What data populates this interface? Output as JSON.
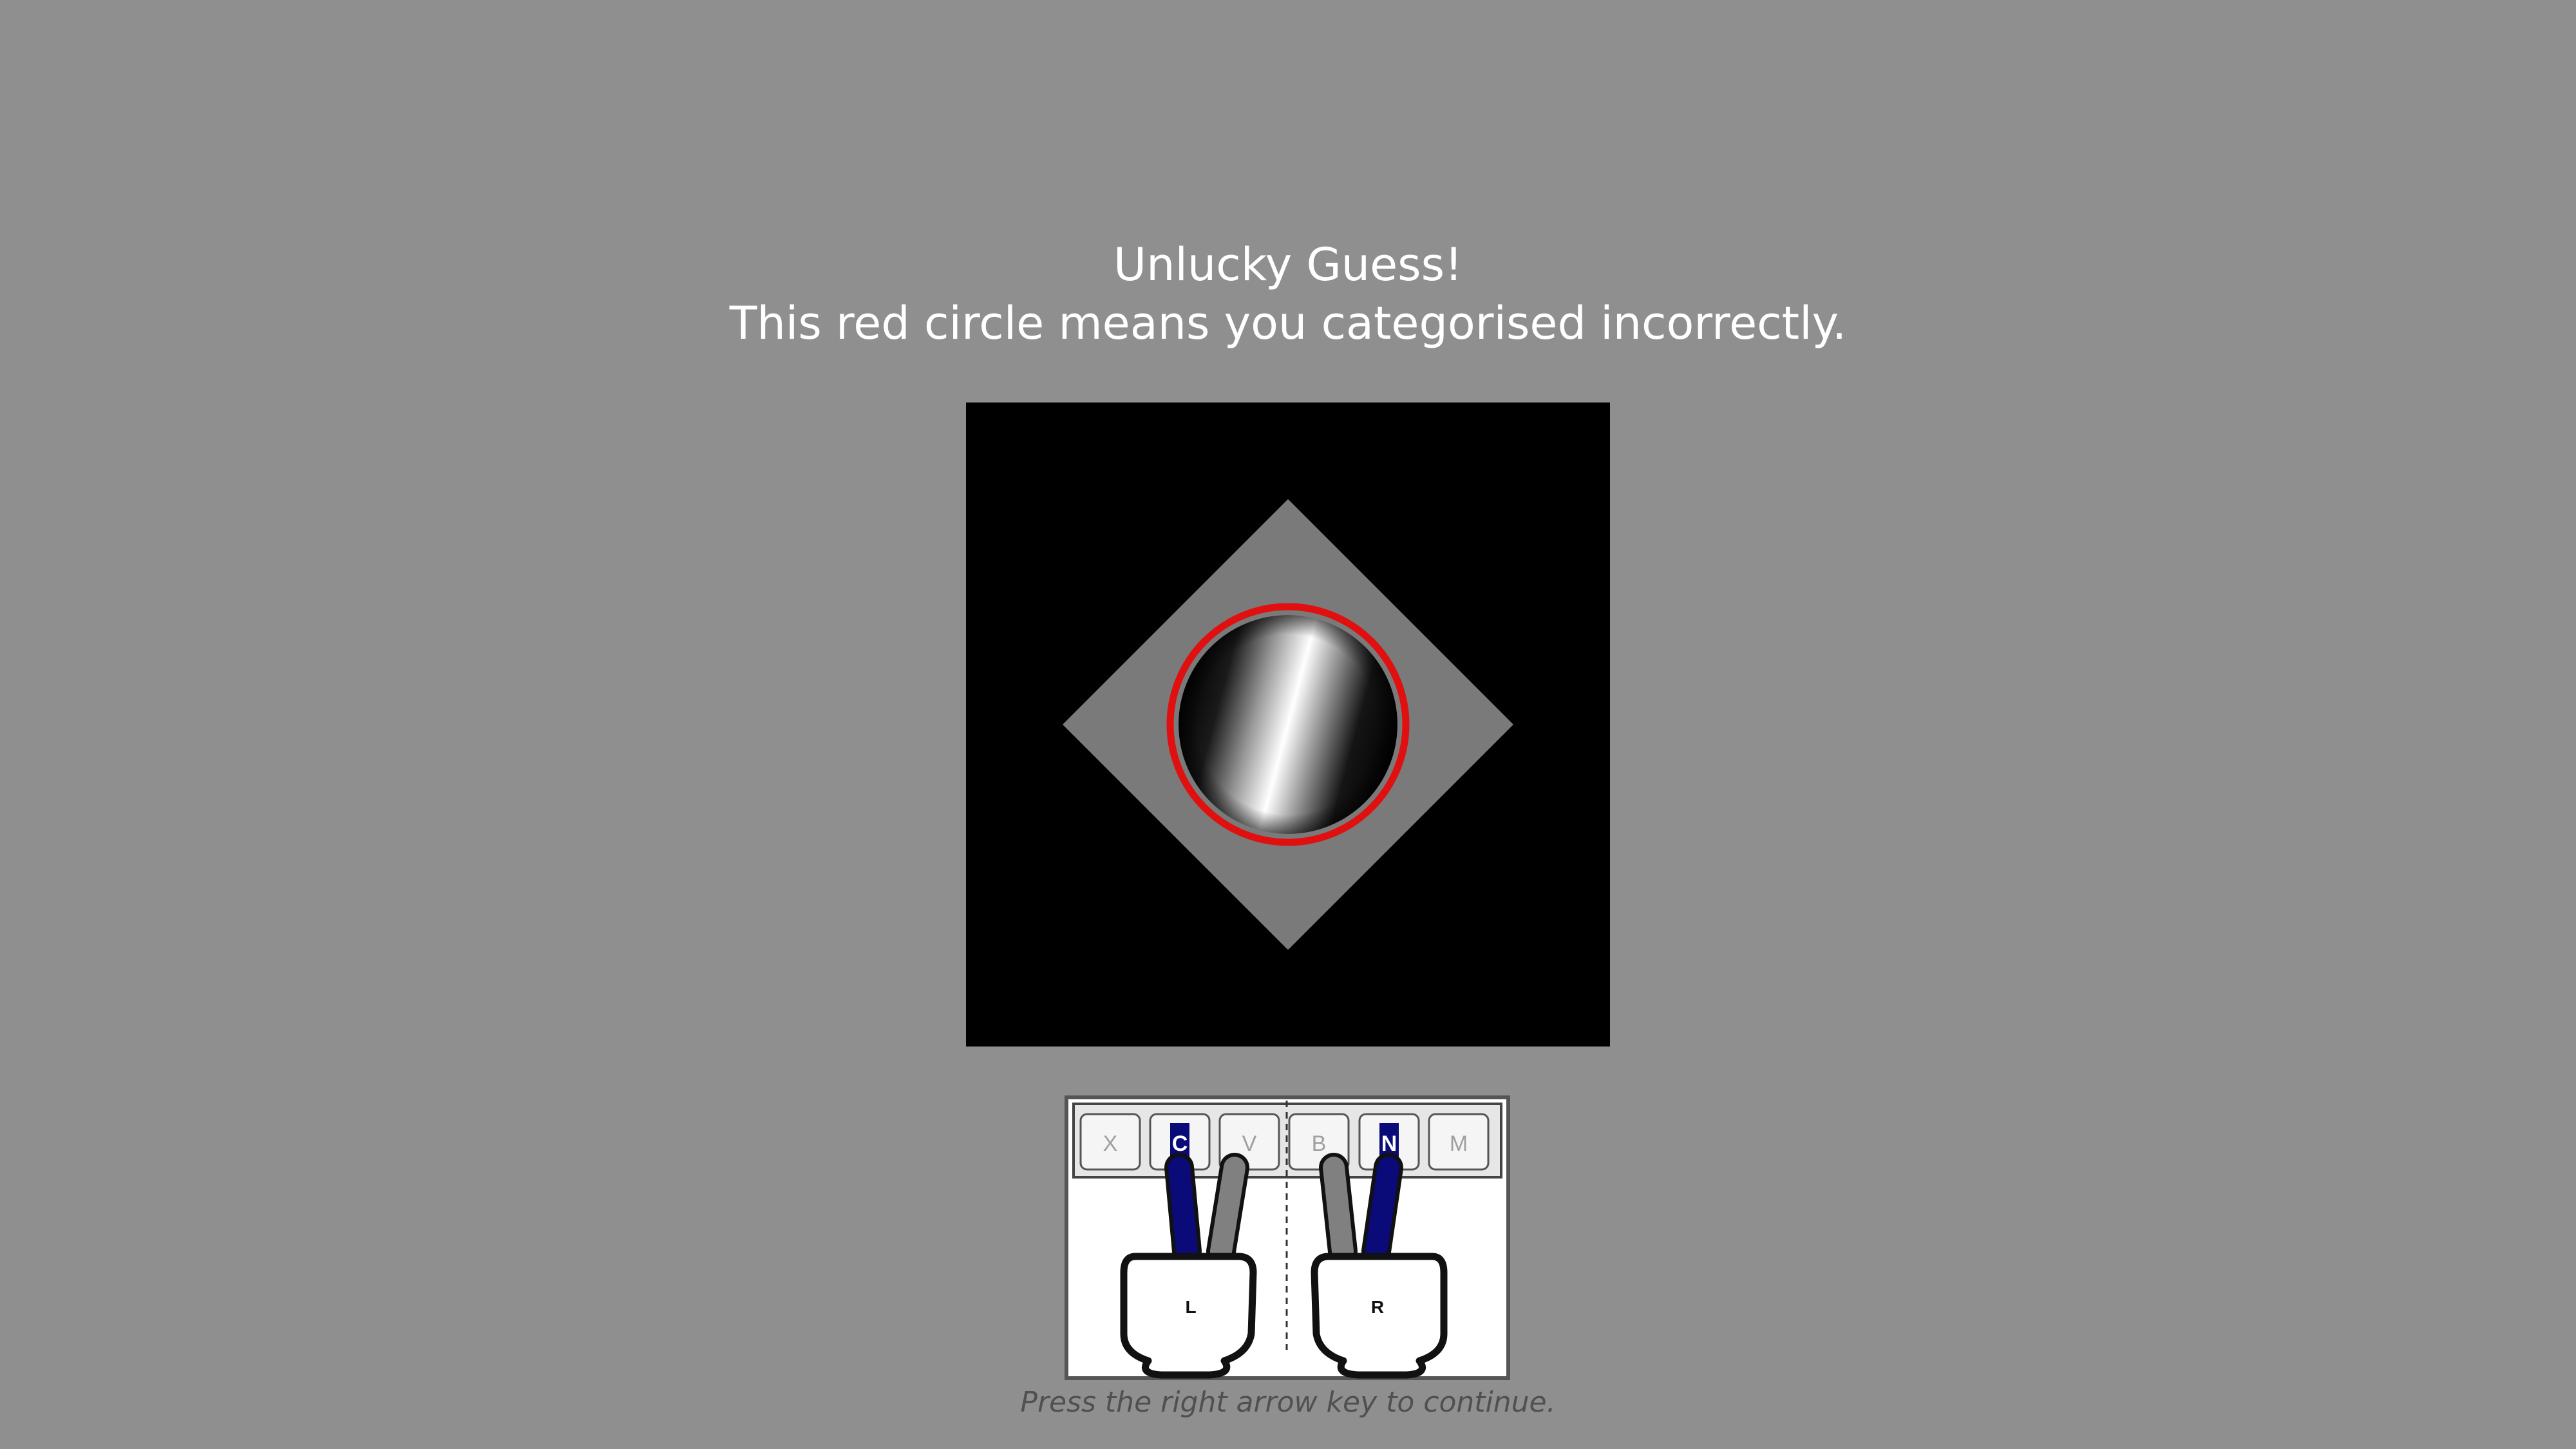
{
  "feedback": {
    "title": "Unlucky Guess!",
    "message": "This red circle means you categorised incorrectly.",
    "ring_color": "#e01010"
  },
  "keyboard": {
    "keys": [
      {
        "label": "X",
        "active": false
      },
      {
        "label": "C",
        "active": true
      },
      {
        "label": "V",
        "active": false
      },
      {
        "label": "B",
        "active": false
      },
      {
        "label": "N",
        "active": true
      },
      {
        "label": "M",
        "active": false
      }
    ],
    "active_color": "#0a0a78",
    "left_hand_label": "L",
    "right_hand_label": "R"
  },
  "prompt": "Press the right arrow key to continue."
}
